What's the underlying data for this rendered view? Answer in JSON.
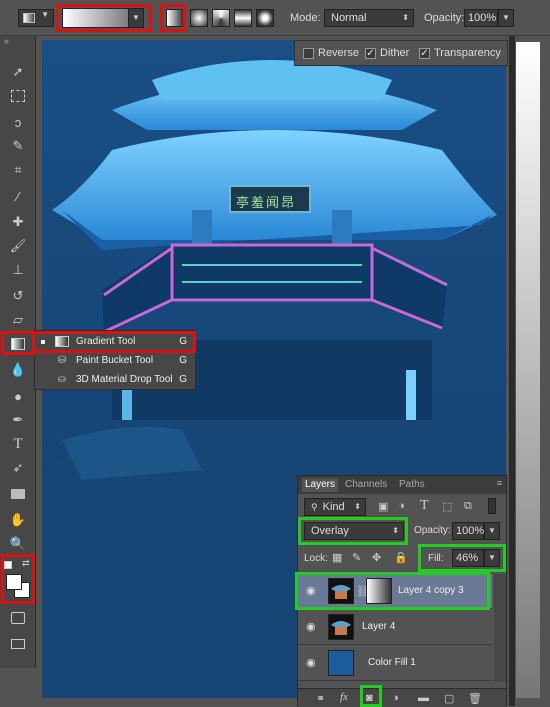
{
  "options_bar": {
    "mode_label": "Mode:",
    "mode_value": "Normal",
    "opacity_label": "Opacity:",
    "opacity_value": "100%"
  },
  "gradient_options": {
    "reverse_label": "Reverse",
    "reverse_checked": false,
    "dither_label": "Dither",
    "dither_checked": true,
    "transparency_label": "Transparency",
    "transparency_checked": true
  },
  "tool_flyout": {
    "items": [
      {
        "label": "Gradient Tool",
        "shortcut": "G",
        "active": true
      },
      {
        "label": "Paint Bucket Tool",
        "shortcut": "G",
        "active": false
      },
      {
        "label": "3D Material Drop Tool",
        "shortcut": "G",
        "active": false
      }
    ]
  },
  "canvas": {
    "sign_text": "亭羞闻昂"
  },
  "layers_panel": {
    "tabs": [
      "Layers",
      "Channels",
      "Paths"
    ],
    "filter_value": "Kind",
    "blend_mode": "Overlay",
    "opacity_label": "Opacity:",
    "opacity_value": "100%",
    "lock_label": "Lock:",
    "fill_label": "Fill:",
    "fill_value": "46%",
    "layers": [
      {
        "name": "Layer 4 copy 3",
        "selected": true
      },
      {
        "name": "Layer 4",
        "selected": false
      },
      {
        "name": "Color Fill 1",
        "selected": false
      }
    ]
  },
  "colors": {
    "highlight_red": "#dd1111",
    "highlight_green": "#22cc22",
    "canvas_blue": "#15477a"
  }
}
